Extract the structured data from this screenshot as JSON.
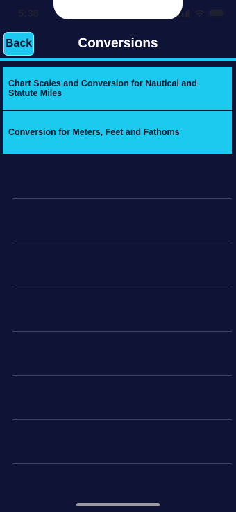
{
  "status_bar": {
    "time": "5:38",
    "icons": [
      "signal-icon",
      "wifi-icon",
      "battery-icon"
    ]
  },
  "nav": {
    "back_label": "Back",
    "title": "Conversions"
  },
  "list": {
    "items": [
      {
        "label": "Chart Scales and Conversion for Nautical and Statute Miles"
      },
      {
        "label": "Conversion for Meters, Feet and Fathoms"
      }
    ]
  },
  "colors": {
    "background": "#0f1336",
    "accent": "#1ccaf0",
    "separator": "#3e4466",
    "title_text": "#ffffff"
  }
}
